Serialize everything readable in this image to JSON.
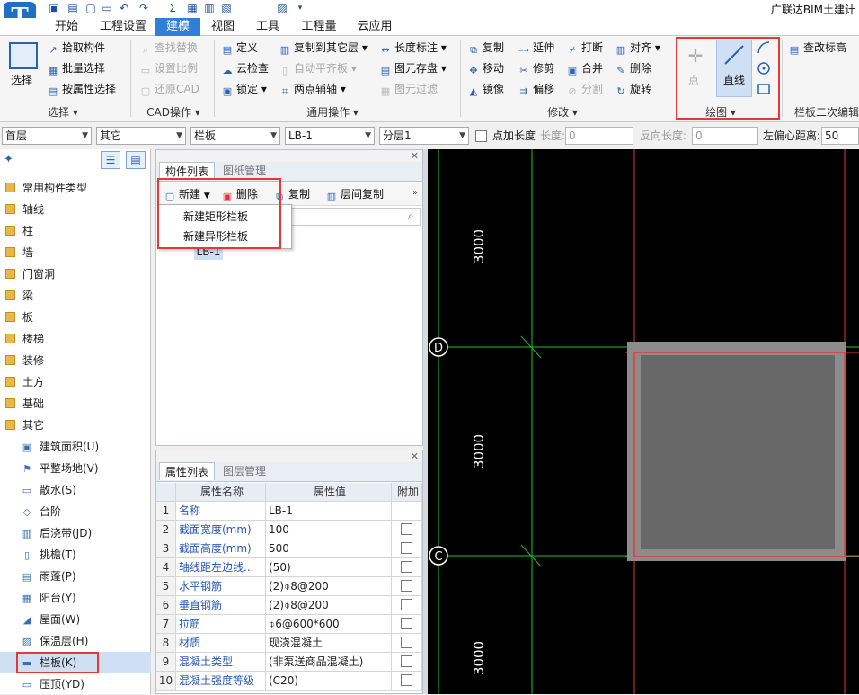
{
  "app": {
    "logo": "T",
    "title": "广联达BIM土建计"
  },
  "quick_access_icons": [
    "save-icon",
    "save-all-icon",
    "new-file-icon",
    "open-folder-icon",
    "undo-icon",
    "redo-icon",
    "sum-icon",
    "calculator-icon",
    "grid-icon",
    "grid-lock-icon",
    "image-icon",
    "dropdown-icon"
  ],
  "menu_tabs": [
    "开始",
    "工程设置",
    "建模",
    "视图",
    "工具",
    "工程量",
    "云应用"
  ],
  "menu_active": "建模",
  "ribbon": {
    "select": {
      "big_label": "选择",
      "items": [
        "拾取构件",
        "批量选择",
        "按属性选择"
      ],
      "group": "选择"
    },
    "cad": {
      "items": [
        "查找替换",
        "设置比例",
        "还原CAD"
      ],
      "group": "CAD操作"
    },
    "common": {
      "col1": [
        "定义",
        "云检查",
        "锁定"
      ],
      "col2": [
        "复制到其它层",
        "自动平齐板",
        "两点辅轴"
      ],
      "col3": [
        "长度标注",
        "图元存盘",
        "图元过滤"
      ],
      "group": "通用操作"
    },
    "modify": {
      "col1": [
        "复制",
        "移动",
        "镜像"
      ],
      "col2": [
        "延伸",
        "修剪",
        "偏移"
      ],
      "col3": [
        "打断",
        "合并",
        "分割"
      ],
      "col4": [
        "对齐",
        "删除",
        "旋转"
      ],
      "group": "修改"
    },
    "draw": {
      "point": "点",
      "line": "直线",
      "group": "绘图"
    },
    "slab_edit": {
      "item": "查改标高",
      "group": "栏板二次编辑"
    }
  },
  "property_bar": {
    "floor": "首层",
    "category": "其它",
    "component_type": "栏板",
    "component": "LB-1",
    "layer": "分层1",
    "add_length_label": "点加长度",
    "length_label": "长度:",
    "length_value": "0",
    "reverse_length_label": "反向长度:",
    "reverse_length_value": "0",
    "left_offset_label": "左偏心距离:",
    "left_offset_value": "50"
  },
  "tree": {
    "categories": [
      "常用构件类型",
      "轴线",
      "柱",
      "墙",
      "门窗洞",
      "梁",
      "板",
      "楼梯",
      "装修",
      "土方",
      "基础",
      "其它"
    ],
    "children": [
      "建筑面积(U)",
      "平整场地(V)",
      "散水(S)",
      "台阶",
      "后浇带(JD)",
      "挑檐(T)",
      "雨蓬(P)",
      "阳台(Y)",
      "屋面(W)",
      "保温层(H)",
      "栏板(K)",
      "压顶(YD)"
    ],
    "selected": "栏板(K)"
  },
  "component_panel": {
    "tabs": [
      "构件列表",
      "图纸管理"
    ],
    "toolbar": {
      "new": "新建",
      "delete": "删除",
      "copy": "复制",
      "floor_copy": "层间复制"
    },
    "dropdown": [
      "新建矩形栏板",
      "新建异形栏板"
    ],
    "items": [
      "LB-1"
    ]
  },
  "property_panel": {
    "tabs": [
      "属性列表",
      "图层管理"
    ],
    "headers": [
      "属性名称",
      "属性值",
      "附加"
    ],
    "rows": [
      {
        "num": "1",
        "name": "名称",
        "value": "LB-1"
      },
      {
        "num": "2",
        "name": "截面宽度(mm)",
        "value": "100"
      },
      {
        "num": "3",
        "name": "截面高度(mm)",
        "value": "500"
      },
      {
        "num": "4",
        "name": "轴线距左边线...",
        "value": "(50)"
      },
      {
        "num": "5",
        "name": "水平钢筋",
        "value": "(2)⌽8@200"
      },
      {
        "num": "6",
        "name": "垂直钢筋",
        "value": "(2)⌽8@200"
      },
      {
        "num": "7",
        "name": "拉筋",
        "value": "⌽6@600*600"
      },
      {
        "num": "8",
        "name": "材质",
        "value": "现浇混凝土"
      },
      {
        "num": "9",
        "name": "混凝土类型",
        "value": "(非泵送商品混凝土)"
      },
      {
        "num": "10",
        "name": "混凝土强度等级",
        "value": "(C20)"
      }
    ]
  },
  "canvas": {
    "axis_labels": [
      "D",
      "C"
    ],
    "dimensions": [
      "3000",
      "3000",
      "3000"
    ],
    "colors": {
      "background": "#000000",
      "grid": "#1fbf2f",
      "guide": "#e53935",
      "slab_outer": "#8c8c8c",
      "slab_inner": "#686868"
    }
  }
}
